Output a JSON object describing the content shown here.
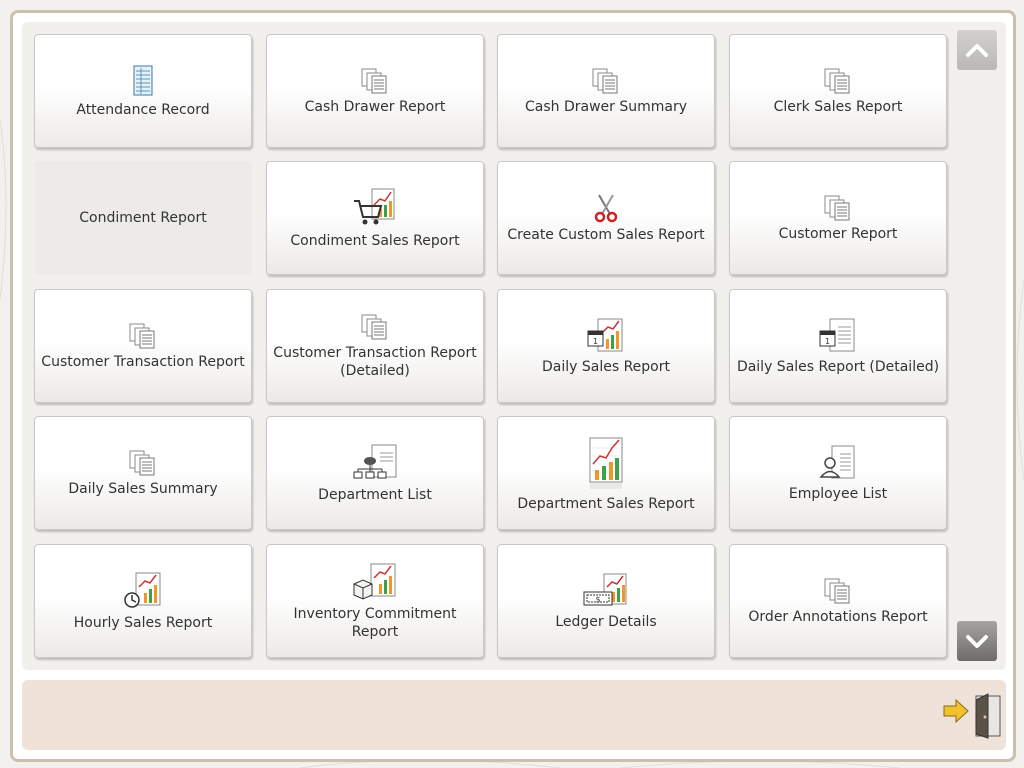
{
  "tiles": [
    {
      "label": "Attendance Record",
      "icon": "attendance-sheet-icon"
    },
    {
      "label": "Cash Drawer Report",
      "icon": "report-pages-icon"
    },
    {
      "label": "Cash Drawer Summary",
      "icon": "report-pages-icon"
    },
    {
      "label": "Clerk Sales Report",
      "icon": "report-pages-icon"
    },
    {
      "label": "Condiment Report",
      "icon": ""
    },
    {
      "label": "Condiment Sales Report",
      "icon": "cart-chart-icon"
    },
    {
      "label": "Create Custom Sales Report",
      "icon": "scissors-icon"
    },
    {
      "label": "Customer Report",
      "icon": "report-pages-icon"
    },
    {
      "label": "Customer Transaction Report",
      "icon": "report-pages-icon"
    },
    {
      "label": "Customer Transaction Report (Detailed)",
      "icon": "report-pages-icon"
    },
    {
      "label": "Daily Sales Report",
      "icon": "calendar-chart-icon"
    },
    {
      "label": "Daily Sales Report (Detailed)",
      "icon": "calendar-document-icon"
    },
    {
      "label": "Daily Sales Summary",
      "icon": "report-pages-icon"
    },
    {
      "label": "Department List",
      "icon": "org-chart-icon"
    },
    {
      "label": "Department Sales Report",
      "icon": "sales-chart-icon"
    },
    {
      "label": "Employee List",
      "icon": "employee-document-icon"
    },
    {
      "label": "Hourly Sales Report",
      "icon": "clock-chart-icon"
    },
    {
      "label": "Inventory Commitment Report",
      "icon": "boxes-chart-icon"
    },
    {
      "label": "Ledger Details",
      "icon": "money-chart-icon"
    },
    {
      "label": "Order Annotations Report",
      "icon": "report-pages-icon"
    }
  ],
  "scroll": {
    "up_icon": "chevron-up-icon",
    "down_icon": "chevron-down-icon"
  },
  "exit": {
    "icon": "exit-door-icon"
  },
  "colors": {
    "panel": "#f1f0ec",
    "footer": "#efe3d9",
    "frame": "#cbbfae"
  }
}
